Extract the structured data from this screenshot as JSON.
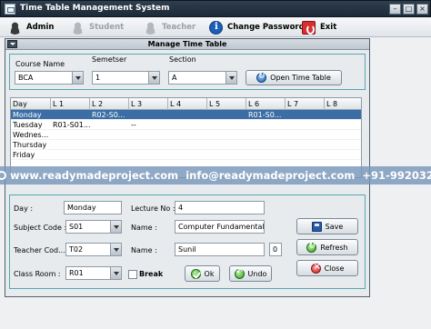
{
  "window": {
    "title": "Time Table Management System",
    "controls": {
      "minimize": "–",
      "maximize": "□",
      "close": "×"
    }
  },
  "menu": {
    "items": [
      {
        "label": "Admin",
        "icon": "admin-icon",
        "enabled": true
      },
      {
        "label": "Student",
        "icon": "student-icon",
        "enabled": false
      },
      {
        "label": "Teacher",
        "icon": "teacher-icon",
        "enabled": false
      },
      {
        "label": "Change Password",
        "icon": "info-icon",
        "enabled": true
      },
      {
        "label": "Exit",
        "icon": "exit-icon",
        "enabled": true
      }
    ]
  },
  "internal_frame": {
    "title": "Manage Time Table"
  },
  "filters": {
    "course_label": "Course Name",
    "course_value": "BCA",
    "semester_label": "Semetser",
    "semester_value": "1",
    "section_label": "Section",
    "section_value": "A",
    "open_button": "Open Time Table"
  },
  "table": {
    "columns": [
      "Day",
      "L 1",
      "L 2",
      "L 3",
      "L 4",
      "L 5",
      "L 6",
      "L 7",
      "L 8"
    ],
    "rows": [
      [
        "Monday",
        "",
        "R02-S0...",
        "",
        "",
        "",
        "R01-S0...",
        "",
        ""
      ],
      [
        "Tuesday",
        "R01-S01...",
        "",
        "--",
        "",
        "",
        "",
        "",
        ""
      ],
      [
        "Wednes...",
        "",
        "",
        "",
        "",
        "",
        "",
        "",
        ""
      ],
      [
        "Thursday",
        "",
        "",
        "",
        "",
        "",
        "",
        "",
        ""
      ],
      [
        "Friday",
        "",
        "",
        "",
        "",
        "",
        "",
        "",
        ""
      ]
    ],
    "selected_row": 0
  },
  "watermark": {
    "website": "www.readymadeproject.com",
    "email": "info@readymadeproject.com",
    "phone": "+91-9920329284"
  },
  "form": {
    "day_label": "Day :",
    "day_value": "Monday",
    "lecture_label": "Lecture No :",
    "lecture_value": "4",
    "subject_code_label": "Subject Code :",
    "subject_code_value": "S01",
    "subject_name_label": "Name :",
    "subject_name_value": "Computer Fundamental",
    "teacher_code_label": "Teacher Cod...",
    "teacher_code_value": "T02",
    "teacher_name_label": "Name :",
    "teacher_name_value": "Sunil",
    "teacher_extra_value": "0",
    "classroom_label": "Class Room :",
    "classroom_value": "R01",
    "break_label": "Break",
    "ok_button": "Ok",
    "undo_button": "Undo",
    "save_button": "Save",
    "refresh_button": "Refresh",
    "close_button": "Close"
  },
  "colors": {
    "title_bar": "#1d2a37",
    "selected_row": "#3a6ea5",
    "panel_border": "#56a6b0",
    "watermark_band": "#7896b9"
  }
}
